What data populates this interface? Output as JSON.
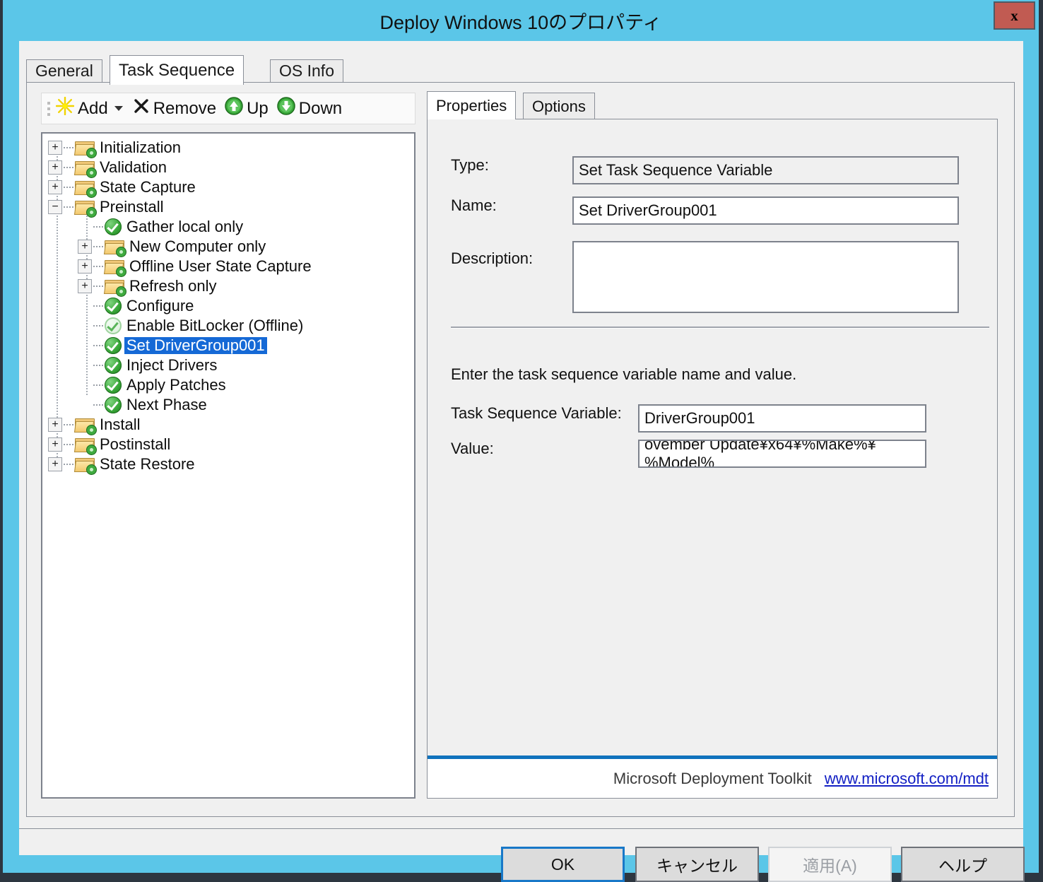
{
  "window": {
    "title": "Deploy Windows 10のプロパティ",
    "close_label": "x",
    "frame_color": "#5bc6e8",
    "close_color": "#c15b52"
  },
  "tabs": [
    {
      "label": "General",
      "active": false
    },
    {
      "label": "Task Sequence",
      "active": true
    },
    {
      "label": "OS Info",
      "active": false
    }
  ],
  "toolbar": {
    "add_label": "Add",
    "remove_label": "Remove",
    "up_label": "Up",
    "down_label": "Down"
  },
  "tree": {
    "nodes": [
      {
        "label": "Initialization",
        "indent": 0,
        "icon": "folder-gear-icon",
        "expander": "+",
        "selected": false
      },
      {
        "label": "Validation",
        "indent": 0,
        "icon": "folder-gear-icon",
        "expander": "+",
        "selected": false
      },
      {
        "label": "State Capture",
        "indent": 0,
        "icon": "folder-gear-icon",
        "expander": "+",
        "selected": false
      },
      {
        "label": "Preinstall",
        "indent": 0,
        "icon": "folder-gear-icon",
        "expander": "-",
        "selected": false
      },
      {
        "label": "Gather local only",
        "indent": 1,
        "icon": "green-check-icon",
        "expander": "",
        "selected": false
      },
      {
        "label": "New Computer only",
        "indent": 1,
        "icon": "folder-gear-icon",
        "expander": "+",
        "selected": false
      },
      {
        "label": "Offline User State Capture",
        "indent": 1,
        "icon": "folder-gear-icon",
        "expander": "+",
        "selected": false
      },
      {
        "label": "Refresh only",
        "indent": 1,
        "icon": "folder-gear-icon",
        "expander": "+",
        "selected": false
      },
      {
        "label": "Configure",
        "indent": 1,
        "icon": "green-check-icon",
        "expander": "",
        "selected": false
      },
      {
        "label": "Enable BitLocker (Offline)",
        "indent": 1,
        "icon": "green-check-disabled-icon",
        "expander": "",
        "selected": false
      },
      {
        "label": "Set DriverGroup001",
        "indent": 1,
        "icon": "green-check-icon",
        "expander": "",
        "selected": true
      },
      {
        "label": "Inject Drivers",
        "indent": 1,
        "icon": "green-check-icon",
        "expander": "",
        "selected": false
      },
      {
        "label": "Apply Patches",
        "indent": 1,
        "icon": "green-check-icon",
        "expander": "",
        "selected": false
      },
      {
        "label": "Next Phase",
        "indent": 1,
        "icon": "green-check-icon",
        "expander": "",
        "selected": false
      },
      {
        "label": "Install",
        "indent": 0,
        "icon": "folder-gear-icon",
        "expander": "+",
        "selected": false
      },
      {
        "label": "Postinstall",
        "indent": 0,
        "icon": "folder-gear-icon",
        "expander": "+",
        "selected": false
      },
      {
        "label": "State Restore",
        "indent": 0,
        "icon": "folder-gear-icon",
        "expander": "+",
        "selected": false
      }
    ]
  },
  "properties": {
    "subtabs": [
      {
        "label": "Properties",
        "active": true
      },
      {
        "label": "Options",
        "active": false
      }
    ],
    "type_label": "Type:",
    "type_value": "Set Task Sequence Variable",
    "name_label": "Name:",
    "name_value": "Set DriverGroup001",
    "description_label": "Description:",
    "description_value": "",
    "hint": "Enter the task sequence variable name and value.",
    "variable_label": "Task Sequence Variable:",
    "variable_value": "DriverGroup001",
    "value_label": "Value:",
    "value_value": "ovember Update¥x64¥%Make%¥%Model%",
    "footer_name": "Microsoft Deployment Toolkit",
    "footer_link": "www.microsoft.com/mdt",
    "footer_accent": "#1073bd"
  },
  "buttons": {
    "ok": "OK",
    "cancel": "キャンセル",
    "apply": "適用(A)",
    "help": "ヘルプ"
  }
}
